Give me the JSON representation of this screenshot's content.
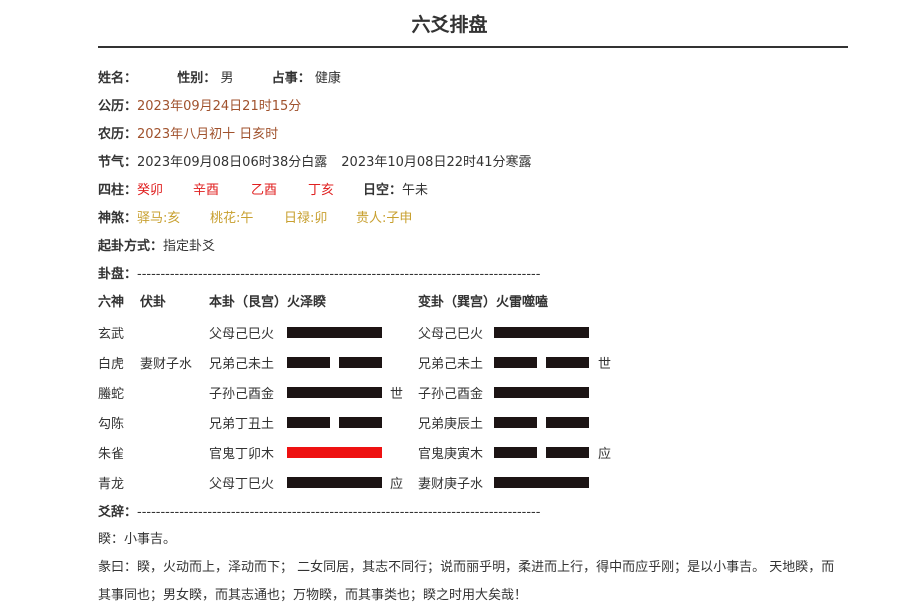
{
  "title": "六爻排盘",
  "info": {
    "name_label": "姓名：",
    "gender_label": "性别：",
    "gender": "男",
    "topic_label": "占事：",
    "topic": "健康",
    "solar_label": "公历：",
    "solar": "2023年09月24日21时15分",
    "lunar_label": "农历：",
    "lunar": "2023年八月初十 日亥时",
    "term_label": "节气：",
    "term1": "2023年09月08日06时38分白露",
    "term2": "2023年10月08日22时41分寒露",
    "pillars_label": "四柱：",
    "pillars": [
      "癸卯",
      "辛酉",
      "乙酉",
      "丁亥"
    ],
    "void_label": "日空：",
    "void": "午未",
    "spirits_label": "神煞：",
    "spirits": [
      "驿马:亥",
      "桃花:午",
      "日禄:卯",
      "贵人:子申"
    ],
    "method_label": "起卦方式：",
    "method": "指定卦爻",
    "chart_label": "卦盘：",
    "dashes": "--------------------------------------------------------------------------------------"
  },
  "table": {
    "headers": {
      "six_gods": "六神",
      "hidden": "伏卦",
      "main": "本卦（艮宫）火泽睽",
      "changed": "变卦（巽宫）火雷噬嗑"
    },
    "rows": [
      {
        "god": "玄武",
        "hidden": "",
        "main_label": "父母己巳火",
        "main_yang": true,
        "main_moving": false,
        "main_mark": "",
        "chg_label": "父母己巳火",
        "chg_yang": true,
        "chg_mark": ""
      },
      {
        "god": "白虎",
        "hidden": "妻财子水",
        "main_label": "兄弟己未土",
        "main_yang": false,
        "main_moving": false,
        "main_mark": "",
        "chg_label": "兄弟己未土",
        "chg_yang": false,
        "chg_mark": "世"
      },
      {
        "god": "螣蛇",
        "hidden": "",
        "main_label": "子孙己酉金",
        "main_yang": true,
        "main_moving": false,
        "main_mark": "世",
        "chg_label": "子孙己酉金",
        "chg_yang": true,
        "chg_mark": ""
      },
      {
        "god": "勾陈",
        "hidden": "",
        "main_label": "兄弟丁丑土",
        "main_yang": false,
        "main_moving": false,
        "main_mark": "",
        "chg_label": "兄弟庚辰土",
        "chg_yang": false,
        "chg_mark": ""
      },
      {
        "god": "朱雀",
        "hidden": "",
        "main_label": "官鬼丁卯木",
        "main_yang": true,
        "main_moving": true,
        "main_mark": "",
        "chg_label": "官鬼庚寅木",
        "chg_yang": false,
        "chg_mark": "应"
      },
      {
        "god": "青龙",
        "hidden": "",
        "main_label": "父母丁巳火",
        "main_yang": true,
        "main_moving": false,
        "main_mark": "应",
        "chg_label": "妻财庚子水",
        "chg_yang": true,
        "chg_mark": ""
      }
    ]
  },
  "text": {
    "yao_label": "爻辞：",
    "dashes": "--------------------------------------------------------------------------------------",
    "line1": "睽：小事吉。",
    "line2": "彖曰：睽，火动而上，泽动而下； 二女同居，其志不同行；说而丽乎明，柔进而上行，得中而应乎刚；是以小事吉。 天地睽，而其事同也；男女睽，而其志通也；万物睽，而其事类也；睽之时用大矣哉！"
  }
}
